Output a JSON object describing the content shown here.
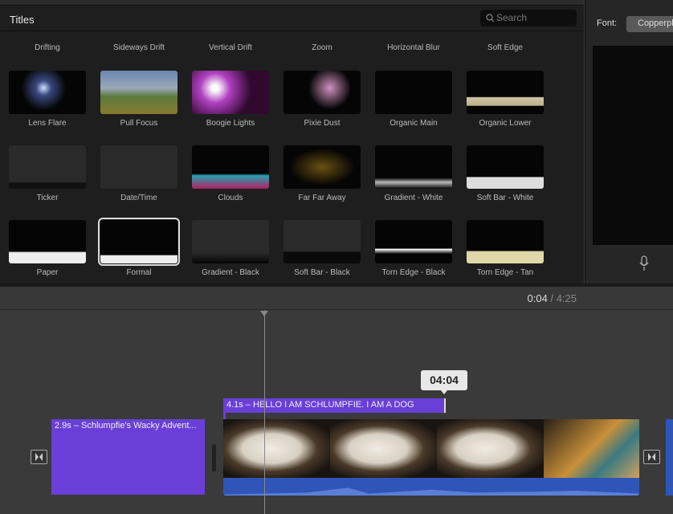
{
  "browser": {
    "title": "Titles",
    "search_placeholder": "Search",
    "top_row_labels": [
      "Drifting",
      "Sideways Drift",
      "Vertical Drift",
      "Zoom",
      "Horizontal Blur",
      "Soft Edge"
    ],
    "rows": [
      [
        "Lens Flare",
        "Pull Focus",
        "Boogie Lights",
        "Pixie Dust",
        "Organic Main",
        "Organic Lower"
      ],
      [
        "Ticker",
        "Date/Time",
        "Clouds",
        "Far Far Away",
        "Gradient - White",
        "Soft Bar - White"
      ],
      [
        "Paper",
        "Formal",
        "Gradient - Black",
        "Soft Bar - Black",
        "Torn Edge - Black",
        "Torn Edge - Tan"
      ]
    ],
    "selected": "Formal"
  },
  "inspector": {
    "font_label": "Font:",
    "font_value": "Copperplate"
  },
  "timeline": {
    "current_time": "0:04",
    "separator": "/",
    "total_time": "4:25",
    "tooltip": "04:04",
    "title_clip_1": "2.9s – Schlumpfie's Wacky Advent...",
    "title_clip_2": "4.1s – HELLO I AM SCHLUMPFIE. I AM A DOG",
    "clip_color": "#6a3fd8",
    "audio_color": "#2f55b8"
  }
}
